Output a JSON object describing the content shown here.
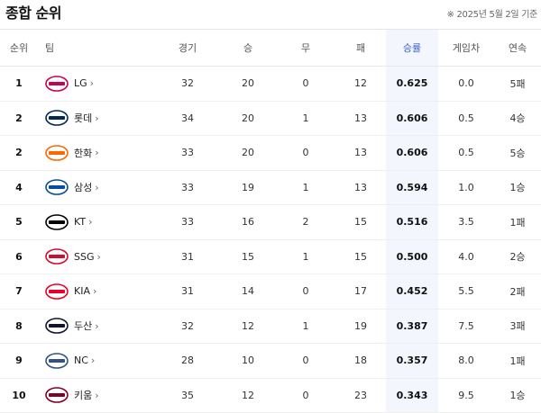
{
  "header": {
    "title": "종합 순위",
    "date": "※ 2025년 5월 2일 기준"
  },
  "columns": [
    "순위",
    "팀",
    "경기",
    "승",
    "무",
    "패",
    "승률",
    "게임차",
    "연속"
  ],
  "rows": [
    {
      "rank": "1",
      "team": "LG",
      "logo": "twins-logo",
      "color": "#c30452",
      "games": "32",
      "wins": "20",
      "draws": "0",
      "losses": "12",
      "pct": "0.625",
      "gb": "0.0",
      "streak": "5패"
    },
    {
      "rank": "2",
      "team": "롯데",
      "logo": "giants-logo",
      "color": "#002955",
      "games": "34",
      "wins": "20",
      "draws": "1",
      "losses": "13",
      "pct": "0.606",
      "gb": "0.5",
      "streak": "4승"
    },
    {
      "rank": "2",
      "team": "한화",
      "logo": "eagles-logo",
      "color": "#ff6600",
      "games": "33",
      "wins": "20",
      "draws": "0",
      "losses": "13",
      "pct": "0.606",
      "gb": "0.5",
      "streak": "5승"
    },
    {
      "rank": "4",
      "team": "삼성",
      "logo": "lions-logo",
      "color": "#074ca1",
      "games": "33",
      "wins": "19",
      "draws": "1",
      "losses": "13",
      "pct": "0.594",
      "gb": "1.0",
      "streak": "1승"
    },
    {
      "rank": "5",
      "team": "KT",
      "logo": "wiz-logo",
      "color": "#000000",
      "games": "33",
      "wins": "16",
      "draws": "2",
      "losses": "15",
      "pct": "0.516",
      "gb": "3.5",
      "streak": "1패"
    },
    {
      "rank": "6",
      "team": "SSG",
      "logo": "landers-logo",
      "color": "#ce0e2d",
      "games": "31",
      "wins": "15",
      "draws": "1",
      "losses": "15",
      "pct": "0.500",
      "gb": "4.0",
      "streak": "2승"
    },
    {
      "rank": "7",
      "team": "KIA",
      "logo": "tigers-logo",
      "color": "#ea0029",
      "games": "31",
      "wins": "14",
      "draws": "0",
      "losses": "17",
      "pct": "0.452",
      "gb": "5.5",
      "streak": "2패"
    },
    {
      "rank": "8",
      "team": "두산",
      "logo": "bears-logo",
      "color": "#131230",
      "games": "32",
      "wins": "12",
      "draws": "1",
      "losses": "19",
      "pct": "0.387",
      "gb": "7.5",
      "streak": "3패"
    },
    {
      "rank": "9",
      "team": "NC",
      "logo": "dinos-logo",
      "color": "#315288",
      "games": "28",
      "wins": "10",
      "draws": "0",
      "losses": "18",
      "pct": "0.357",
      "gb": "8.0",
      "streak": "1패"
    },
    {
      "rank": "10",
      "team": "키움",
      "logo": "heroes-logo",
      "color": "#820024",
      "games": "35",
      "wins": "12",
      "draws": "0",
      "losses": "23",
      "pct": "0.343",
      "gb": "9.5",
      "streak": "1승"
    }
  ]
}
